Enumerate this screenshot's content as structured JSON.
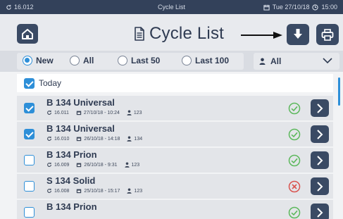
{
  "status_bar": {
    "cycle_counter": "16.012",
    "screen_name": "Cycle List",
    "date": "Tue 27/10/18",
    "time": "15:00"
  },
  "header": {
    "title": "Cycle List",
    "icons": {
      "home": "home-icon",
      "title": "document-icon",
      "download": "download-icon",
      "print": "printer-icon"
    }
  },
  "filters": {
    "options": [
      {
        "label": "New",
        "selected": true
      },
      {
        "label": "All",
        "selected": false
      },
      {
        "label": "Last 50",
        "selected": false
      },
      {
        "label": "Last 100",
        "selected": false
      }
    ],
    "user_select": {
      "value": "All"
    }
  },
  "list": {
    "group_label": "Today",
    "group_checked": true,
    "rows": [
      {
        "name": "B 134 Universal",
        "cycle": "16.011",
        "datetime": "27/10/18 - 10:24",
        "user": "123",
        "checked": true,
        "status": "ok"
      },
      {
        "name": "B 134 Universal",
        "cycle": "16.010",
        "datetime": "26/10/18 - 14:18",
        "user": "134",
        "checked": true,
        "status": "ok"
      },
      {
        "name": "B 134 Prion",
        "cycle": "16.009",
        "datetime": "26/10/18 - 9:31",
        "user": "123",
        "checked": false,
        "status": "ok"
      },
      {
        "name": "S 134 Solid",
        "cycle": "16.008",
        "datetime": "25/10/18 - 15:17",
        "user": "123",
        "checked": false,
        "status": "failed"
      },
      {
        "name": "B 134 Prion",
        "cycle": "",
        "datetime": "",
        "user": "",
        "checked": false,
        "status": "ok"
      }
    ]
  },
  "colors": {
    "accent": "#2e8fd8",
    "dark_button": "#3a4a64",
    "status_bar": "#33415a",
    "ok_green": "#5cb85c",
    "fail_red": "#d9534f"
  }
}
